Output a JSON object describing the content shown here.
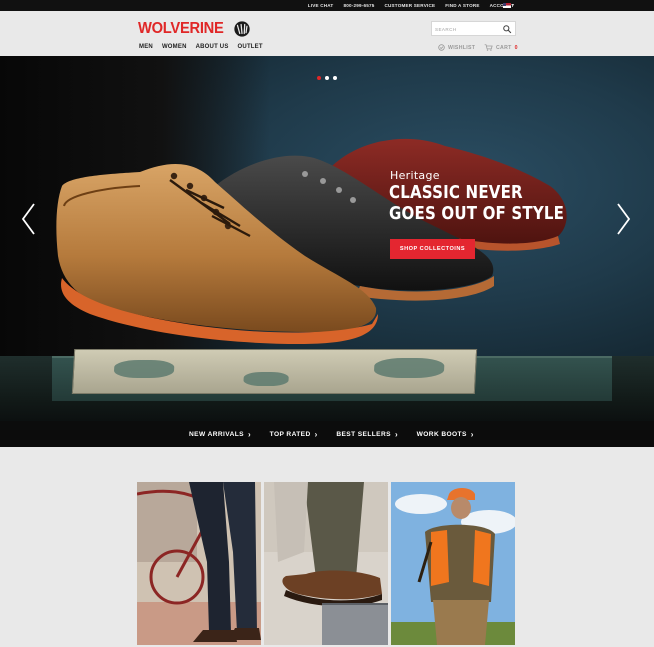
{
  "topbar": {
    "links": [
      "LIVE CHAT",
      "800-299-6575",
      "CUSTOMER SERVICE",
      "FIND A STORE",
      "ACCOUNT"
    ],
    "locale_icon": "us-flag-icon"
  },
  "header": {
    "logo_text": "WOLVERINE",
    "logo_icon": "wolverine-claw-icon",
    "nav": [
      "MEN",
      "WOMEN",
      "ABOUT US",
      "OUTLET"
    ],
    "search_placeholder": "SEARCH",
    "wishlist_label": "WISHLIST",
    "cart_label": "CART",
    "cart_count": "0"
  },
  "hero": {
    "eyebrow": "Heritage",
    "headline": "CLASSIC NEVER GOES OUT OF STYLE",
    "cta_label": "SHOP COLLECTOINS",
    "slide_count": 3,
    "active_slide": 1
  },
  "category_bar": {
    "items": [
      "NEW ARRIVALS",
      "TOP RATED",
      "BEST SELLERS",
      "WORK BOOTS"
    ]
  },
  "colors": {
    "brand_red": "#e02727",
    "cta_red": "#e42630",
    "topbar_bg": "#111111",
    "page_bg": "#e9e9e9"
  }
}
